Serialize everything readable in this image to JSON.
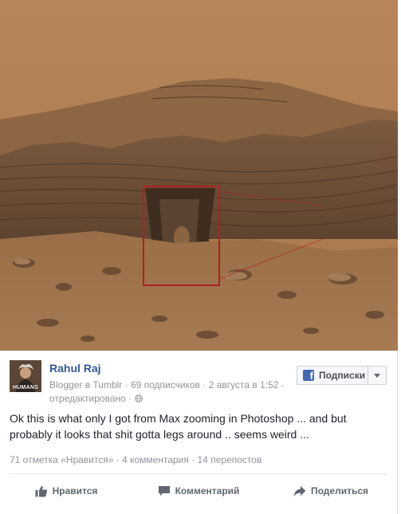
{
  "post": {
    "author": "Rahul Raj",
    "avatar_caption": "HUMANS",
    "meta_line1": "Blogger в Tumblr · 69 подписчиков · 2 августа в 1:52 ·",
    "meta_line2": "отредактировано ·",
    "follow_label": "Подписки",
    "text": "Ok this is what only I got from Max zooming in Photoshop ... and but probably it looks that shit gotta legs around .. seems weird ...",
    "stats": "71 отметка «Нравится» · 4 комментария · 14 перепостов",
    "actions": {
      "like": "Нравится",
      "comment": "Комментарий",
      "share": "Поделиться"
    }
  },
  "colors": {
    "link": "#365899",
    "muted": "#90949c",
    "fb_blue": "#4267b2",
    "highlight_box": "#b02020"
  },
  "icons": [
    "globe-icon",
    "facebook-f-icon",
    "chevron-down-icon",
    "thumbs-up-icon",
    "comment-icon",
    "share-icon"
  ]
}
